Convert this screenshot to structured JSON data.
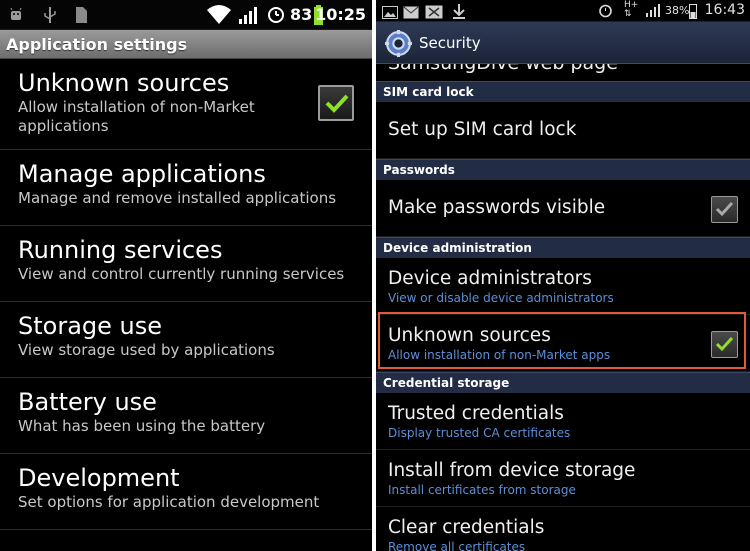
{
  "left": {
    "status": {
      "battery": "83",
      "time": "10:25"
    },
    "title": "Application settings",
    "items": [
      {
        "title": "Unknown sources",
        "subtitle": "Allow installation of non-Market applications",
        "checked": true
      },
      {
        "title": "Manage applications",
        "subtitle": "Manage and remove installed applications"
      },
      {
        "title": "Running services",
        "subtitle": "View and control currently running services"
      },
      {
        "title": "Storage use",
        "subtitle": "View storage used by applications"
      },
      {
        "title": "Battery use",
        "subtitle": "What has been using the battery"
      },
      {
        "title": "Development",
        "subtitle": "Set options for application development"
      }
    ]
  },
  "right": {
    "status": {
      "battery": "38%",
      "time": "16:43"
    },
    "title": "Security",
    "cut_item": "SamsungDive web page",
    "sections": {
      "sim": "SIM card lock",
      "passwords": "Passwords",
      "device_admin": "Device administration",
      "credential": "Credential storage"
    },
    "items": {
      "sim_lock": {
        "title": "Set up SIM card lock"
      },
      "passwords_visible": {
        "title": "Make passwords visible",
        "checked": true
      },
      "device_admins": {
        "title": "Device administrators",
        "subtitle": "View or disable device administrators"
      },
      "unknown_sources": {
        "title": "Unknown sources",
        "subtitle": "Allow installation of non-Market apps",
        "checked": true
      },
      "trusted_creds": {
        "title": "Trusted credentials",
        "subtitle": "Display trusted CA certificates"
      },
      "install_storage": {
        "title": "Install from device storage",
        "subtitle": "Install certificates from storage"
      },
      "clear_creds": {
        "title": "Clear credentials",
        "subtitle": "Remove all certificates"
      }
    }
  },
  "colors": {
    "check_green": "#8ee02a",
    "accent_blue": "#5b8fd8",
    "highlight": "#e05a3a"
  }
}
